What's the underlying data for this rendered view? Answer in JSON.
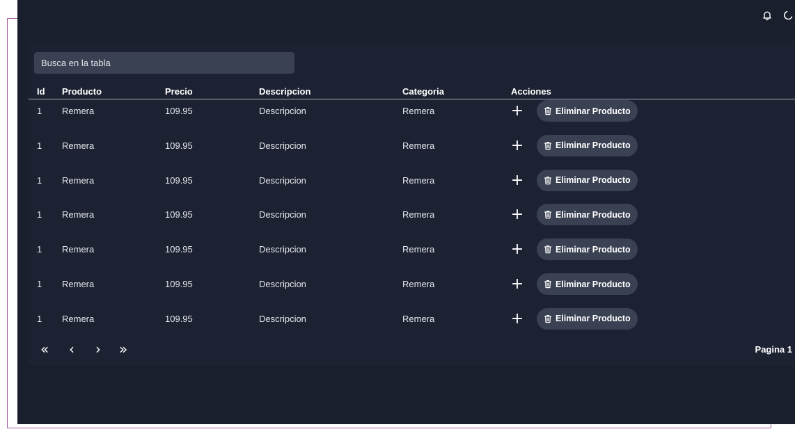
{
  "search": {
    "placeholder": "Busca en la tabla"
  },
  "table": {
    "headers": {
      "id": "Id",
      "producto": "Producto",
      "precio": "Precio",
      "descripcion": "Descripcion",
      "categoria": "Categoria",
      "acciones": "Acciones"
    },
    "rows": [
      {
        "id": "1",
        "producto": "Remera",
        "precio": "109.95",
        "descripcion": "Descripcion",
        "categoria": "Remera"
      },
      {
        "id": "1",
        "producto": "Remera",
        "precio": "109.95",
        "descripcion": "Descripcion",
        "categoria": "Remera"
      },
      {
        "id": "1",
        "producto": "Remera",
        "precio": "109.95",
        "descripcion": "Descripcion",
        "categoria": "Remera"
      },
      {
        "id": "1",
        "producto": "Remera",
        "precio": "109.95",
        "descripcion": "Descripcion",
        "categoria": "Remera"
      },
      {
        "id": "1",
        "producto": "Remera",
        "precio": "109.95",
        "descripcion": "Descripcion",
        "categoria": "Remera"
      },
      {
        "id": "1",
        "producto": "Remera",
        "precio": "109.95",
        "descripcion": "Descripcion",
        "categoria": "Remera"
      },
      {
        "id": "1",
        "producto": "Remera",
        "precio": "109.95",
        "descripcion": "Descripcion",
        "categoria": "Remera"
      }
    ],
    "add_label": "+",
    "delete_label": "Eliminar Producto"
  },
  "pager": {
    "first": "«",
    "prev": "‹",
    "next": "›",
    "last": "»",
    "page_label": "Pagina 1"
  },
  "icons": {
    "topbar": [
      "bell-icon",
      "moon-icon"
    ],
    "delete": "trash-icon"
  },
  "colors": {
    "background": "#1a1f2e",
    "card": "#1d2232",
    "button": "#3a4152",
    "frame": "#a35a9c"
  }
}
